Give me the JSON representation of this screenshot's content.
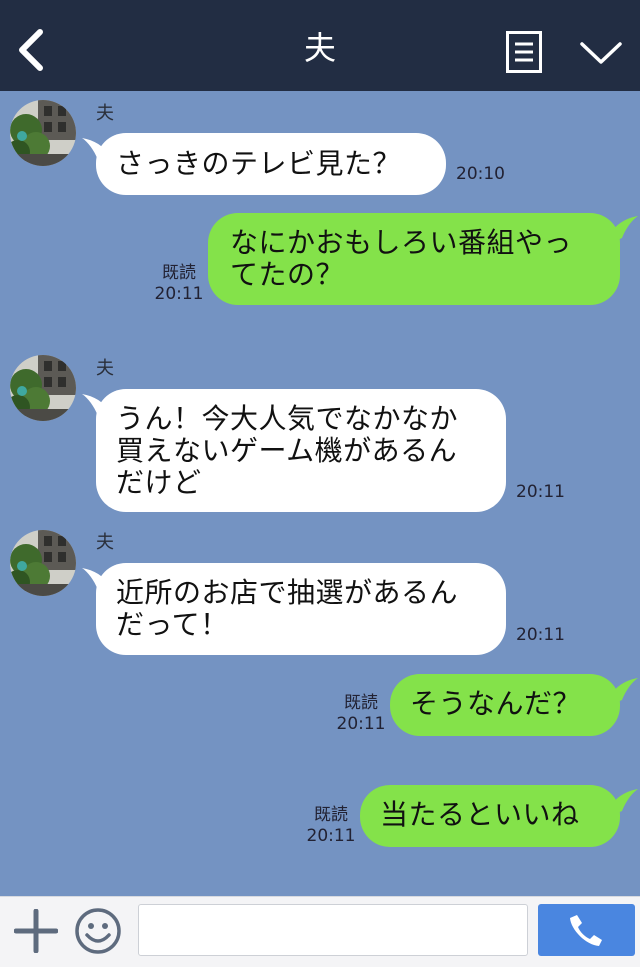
{
  "header": {
    "title": "夫",
    "back_icon": "chevron-left-icon",
    "menu_icon": "list-icon",
    "collapse_icon": "chevron-down-icon"
  },
  "messages": [
    {
      "side": "in",
      "sender": "夫",
      "text": "さっきのテレビ見た？",
      "time": "20:10"
    },
    {
      "side": "out",
      "text": "なにかおもしろい番組やっ\nてたの？",
      "read": "既読",
      "time": "20:11"
    },
    {
      "side": "in",
      "sender": "夫",
      "text": "うん！今大人気でなかなか\n買えないゲーム機があるん\nだけど",
      "time": "20:11"
    },
    {
      "side": "in",
      "sender": "夫",
      "text": "近所のお店で抽選があるん\nだって！",
      "time": "20:11"
    },
    {
      "side": "out",
      "text": "そうなんだ？",
      "read": "既読",
      "time": "20:11"
    },
    {
      "side": "out",
      "text": "当たるといいね",
      "read": "既読",
      "time": "20:11"
    }
  ],
  "input": {
    "value": "",
    "placeholder": ""
  },
  "colors": {
    "header_bg": "#222d43",
    "chat_bg": "#7493c2",
    "incoming_bubble": "#ffffff",
    "outgoing_bubble": "#84e24a",
    "call_button": "#4a86e0"
  },
  "bottom_bar": {
    "plus_icon": "plus-icon",
    "emoji_icon": "smile-icon",
    "call_icon": "phone-icon"
  }
}
